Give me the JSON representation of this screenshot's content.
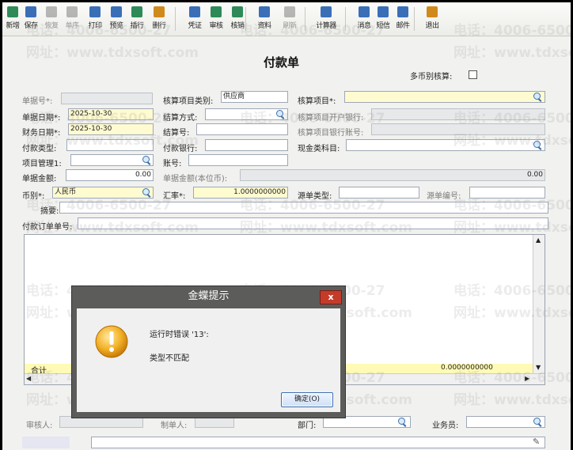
{
  "toolbar": {
    "items": [
      {
        "label": "新增",
        "icon": "new-doc-icon",
        "color": "#2e8b57",
        "enabled": true
      },
      {
        "label": "保存",
        "icon": "save-icon",
        "color": "#3a6fb8",
        "enabled": true
      },
      {
        "label": "恢复",
        "icon": "undo-icon",
        "color": "#666666",
        "enabled": false
      },
      {
        "label": "单序",
        "icon": "order-icon",
        "color": "#666666",
        "enabled": false
      },
      {
        "label": "打印",
        "icon": "print-icon",
        "color": "#3a6fb8",
        "enabled": true
      },
      {
        "label": "预览",
        "icon": "preview-icon",
        "color": "#3a6fb8",
        "enabled": true
      },
      {
        "label": "插行",
        "icon": "insert-row-icon",
        "color": "#2e8b57",
        "enabled": true
      },
      {
        "label": "删行",
        "icon": "delete-row-icon",
        "color": "#d08a1c",
        "enabled": true
      },
      {
        "label": "凭证",
        "icon": "voucher-icon",
        "color": "#3a6fb8",
        "enabled": true
      },
      {
        "label": "审核",
        "icon": "approve-icon",
        "color": "#2e8b57",
        "enabled": true
      },
      {
        "label": "核销",
        "icon": "writeoff-icon",
        "color": "#2e8b57",
        "enabled": true
      },
      {
        "label": "资料",
        "icon": "data-icon",
        "color": "#3a6fb8",
        "enabled": true
      },
      {
        "label": "刷新",
        "icon": "refresh-icon",
        "color": "#666666",
        "enabled": false
      },
      {
        "label": "计算器",
        "icon": "calculator-icon",
        "color": "#3a6fb8",
        "enabled": true
      },
      {
        "label": "消息",
        "icon": "message-icon",
        "color": "#3a6fb8",
        "enabled": true
      },
      {
        "label": "短信",
        "icon": "sms-icon",
        "color": "#3a6fb8",
        "enabled": true
      },
      {
        "label": "邮件",
        "icon": "mail-icon",
        "color": "#3a6fb8",
        "enabled": true
      },
      {
        "label": "退出",
        "icon": "exit-icon",
        "color": "#d08a1c",
        "enabled": true
      }
    ]
  },
  "watermark": {
    "phone": "电话：4006-6500-27",
    "site": "网址：www.tdxsoft.com"
  },
  "form": {
    "title": "付款单",
    "multi_currency_label": "多币别核算:",
    "doc_no_label": "单据号*:",
    "doc_no_value": "",
    "doc_date_label": "单据日期*:",
    "doc_date_value": "2025-10-30",
    "fin_date_label": "财务日期*:",
    "fin_date_value": "2025-10-30",
    "pay_type_label": "付款类型:",
    "project_label": "项目管理1:",
    "amount_label": "单据金额:",
    "amount_value": "0.00",
    "currency_label": "币别*:",
    "currency_value": "人民币",
    "summary_label": "摘要:",
    "order_no_label": "付款订单单号:",
    "acct_cat_label": "核算项目类别:",
    "acct_cat_value": "供应商",
    "settle_method_label": "结算方式:",
    "settle_no_label": "结算号:",
    "pay_bank_label": "付款银行:",
    "account_label": "账号:",
    "local_amount_label": "单据金额(本位币):",
    "local_amount_value": "0.00",
    "rate_label": "汇率*:",
    "rate_value": "1.0000000000",
    "acct_item_label": "核算项目*:",
    "acct_bank_label": "核算项目开户银行:",
    "acct_bank_no_label": "核算项目银行账号:",
    "cash_subject_label": "现金类科目:",
    "source_type_label": "源单类型:",
    "source_no_label": "源单编号:",
    "auditor_label": "审核人:",
    "maker_label": "制单人:",
    "dept_label": "部门:",
    "salesman_label": "业务员:"
  },
  "grid": {
    "sum_label": "合计",
    "sum_value": "0.0000000000"
  },
  "dialog": {
    "title": "金蝶提示",
    "close": "x",
    "message": "运行时错误 '13':",
    "detail": "类型不匹配",
    "ok": "确定(O)"
  }
}
